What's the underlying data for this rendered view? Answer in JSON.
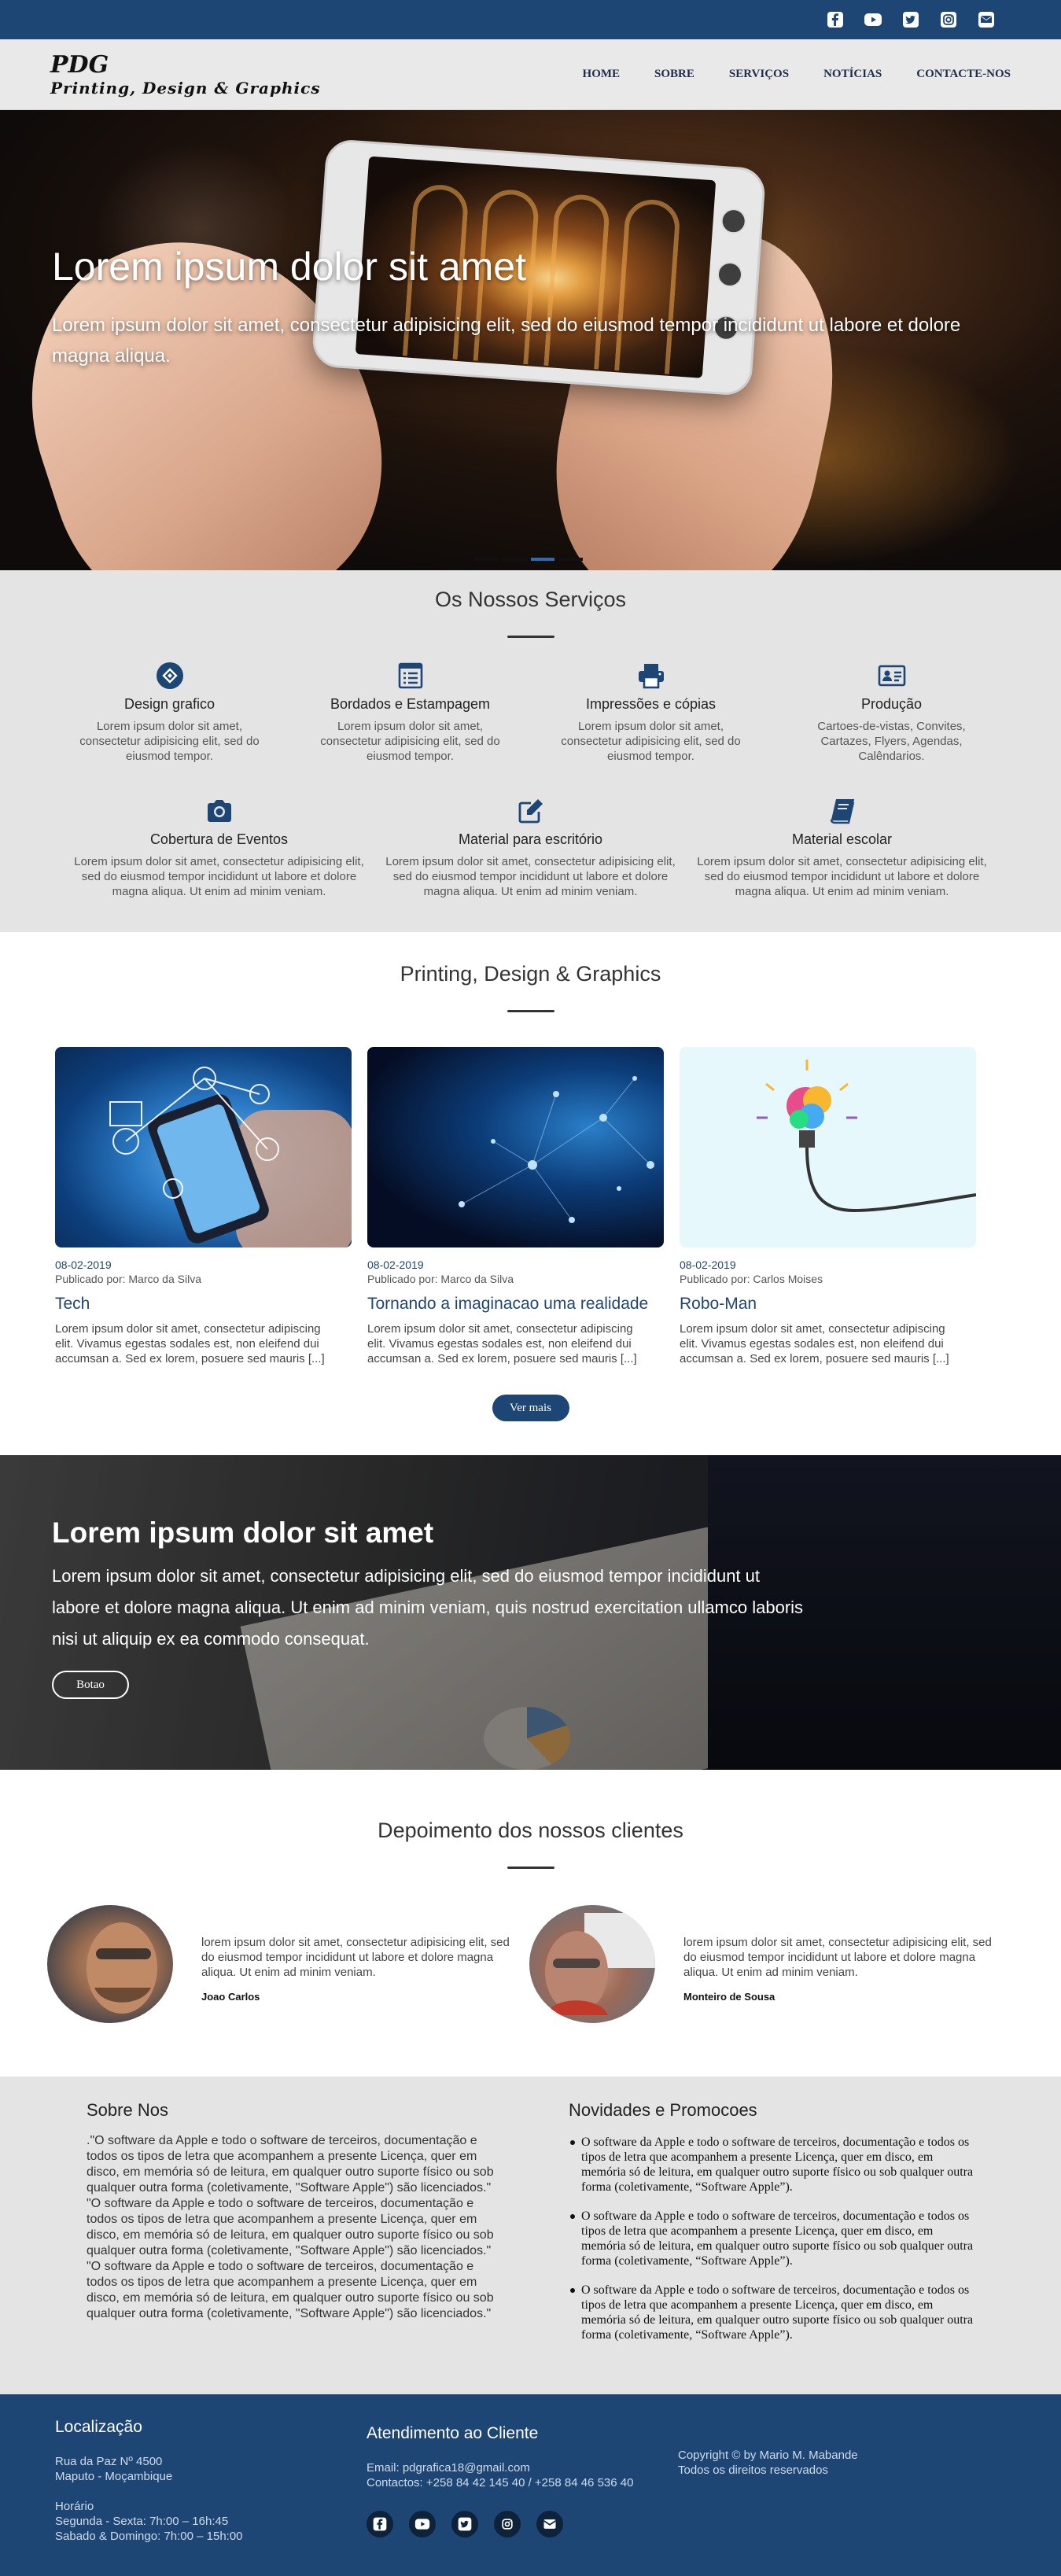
{
  "topbar": {
    "icons": [
      "facebook-icon",
      "youtube-icon",
      "twitter-icon",
      "instagram-icon",
      "email-icon"
    ]
  },
  "brand": {
    "title": "PDG",
    "subtitle": "Printing, Design & Graphics"
  },
  "nav": {
    "items": [
      "HOME",
      "SOBRE",
      "SERVIÇOS",
      "NOTÍCIAS",
      "CONTACTE-NOS"
    ]
  },
  "hero": {
    "title": "Lorem ipsum dolor sit amet",
    "description": "Lorem ipsum dolor sit amet, consectetur adipisicing elit, sed do eiusmod tempor incididunt ut labore et dolore magna aliqua.",
    "slides": 4,
    "active_slide": 3
  },
  "services": {
    "title": "Os Nossos Serviços",
    "items": [
      {
        "icon": "design-icon",
        "title": "Design grafico",
        "text": "Lorem ipsum dolor sit amet, consectetur adipisicing elit, sed do eiusmod tempor."
      },
      {
        "icon": "list-icon",
        "title": "Bordados e Estampagem",
        "text": "Lorem ipsum dolor sit amet, consectetur adipisicing elit, sed do eiusmod tempor."
      },
      {
        "icon": "printer-icon",
        "title": "Impressões e cópias",
        "text": "Lorem ipsum dolor sit amet, consectetur adipisicing elit, sed do eiusmod tempor."
      },
      {
        "icon": "id-card-icon",
        "title": "Produção",
        "text": "Cartoes-de-vistas, Convites, Cartazes, Flyers, Agendas, Calêndarios."
      },
      {
        "icon": "camera-icon",
        "title": "Cobertura de Eventos",
        "text": "Lorem ipsum dolor sit amet, consectetur adipisicing elit, sed do eiusmod tempor incididunt ut labore et dolore magna aliqua. Ut enim ad minim veniam."
      },
      {
        "icon": "edit-icon",
        "title": "Material para escritório",
        "text": "Lorem ipsum dolor sit amet, consectetur adipisicing elit, sed do eiusmod tempor incididunt ut labore et dolore magna aliqua. Ut enim ad minim veniam."
      },
      {
        "icon": "book-icon",
        "title": "Material escolar",
        "text": "Lorem ipsum dolor sit amet, consectetur adipisicing elit, sed do eiusmod tempor incididunt ut labore et dolore magna aliqua. Ut enim ad minim veniam."
      }
    ]
  },
  "blog": {
    "title": "Printing, Design & Graphics",
    "cards": [
      {
        "date": "08-02-2019",
        "author": "Publicado por: Marco da Silva",
        "title": "Tech",
        "text": "Lorem ipsum dolor sit amet, consectetur adipiscing elit. Vivamus egestas sodales est, non eleifend dui accumsan a. Sed ex lorem, posuere sed mauris [...]"
      },
      {
        "date": "08-02-2019",
        "author": "Publicado por: Marco da Silva",
        "title": "Tornando a imaginacao uma realidade",
        "text": "Lorem ipsum dolor sit amet, consectetur adipiscing elit. Vivamus egestas sodales est, non eleifend dui accumsan a. Sed ex lorem, posuere sed mauris [...]"
      },
      {
        "date": "08-02-2019",
        "author": "Publicado por: Carlos Moises",
        "title": "Robo-Man",
        "text": "Lorem ipsum dolor sit amet, consectetur adipiscing elit. Vivamus egestas sodales est, non eleifend dui accumsan a. Sed ex lorem, posuere sed mauris [...]"
      }
    ],
    "more_label": "Ver mais"
  },
  "banner": {
    "title": "Lorem ipsum dolor sit amet",
    "description": "Lorem ipsum dolor sit amet, consectetur adipisicing elit, sed do eiusmod tempor incididunt ut labore et dolore magna aliqua. Ut enim ad minim veniam, quis nostrud exercitation ullamco laboris nisi ut aliquip ex ea commodo consequat.",
    "button_label": "Botao"
  },
  "testimonials": {
    "title": "Depoimento dos nossos clientes",
    "items": [
      {
        "text": "lorem ipsum dolor sit amet, consectetur adipisicing elit, sed do eiusmod tempor incididunt ut labore et dolore magna aliqua. Ut enim ad minim veniam.",
        "name": "Joao Carlos"
      },
      {
        "text": "lorem ipsum dolor sit amet, consectetur adipisicing elit, sed do eiusmod tempor incididunt ut labore et dolore magna aliqua. Ut enim ad minim veniam.",
        "name": "Monteiro de Sousa"
      }
    ]
  },
  "about": {
    "title": "Sobre Nos",
    "paragraphs": [
      ".\"O software da Apple e todo o software de terceiros, documentação e todos os tipos de letra que acompanhem a presente Licença, quer em disco, em memória só de leitura, em qualquer outro suporte físico ou sob qualquer outra forma (coletivamente, \"Software Apple\") são licenciados.\"",
      "\"O software da Apple e todo o software de terceiros, documentação e todos os tipos de letra que acompanhem a presente Licença, quer em disco, em memória só de leitura, em qualquer outro suporte físico ou sob qualquer outra forma (coletivamente, \"Software Apple\") são licenciados.\"",
      "\"O software da Apple e todo o software de terceiros, documentação e todos os tipos de letra que acompanhem a presente Licença, quer em disco, em memória só de leitura, em qualquer outro suporte físico ou sob qualquer outra forma (coletivamente, \"Software Apple\") são licenciados.\""
    ]
  },
  "news": {
    "title": "Novidades e Promocoes",
    "items": [
      "O software da Apple e todo o software de terceiros, documentação e todos os tipos de letra que acompanhem a presente Licença, quer em disco, em memória só de leitura, em qualquer outro suporte físico ou sob qualquer outra forma (coletivamente, “Software Apple”).",
      "O software da Apple e todo o software de terceiros, documentação e todos os tipos de letra que acompanhem a presente Licença, quer em disco, em memória só de leitura, em qualquer outro suporte físico ou sob qualquer outra forma (coletivamente, “Software Apple”).",
      "O software da Apple e todo o software de terceiros, documentação e todos os tipos de letra que acompanhem a presente Licença, quer em disco, em memória só de leitura, em qualquer outro suporte físico ou sob qualquer outra forma (coletivamente, “Software Apple”)."
    ]
  },
  "footer": {
    "location_title": "Localização",
    "address_line1": "Rua da Paz Nº 4500",
    "address_line2": "Maputo - Moçambique",
    "hours_label": "Horário",
    "hours_weekdays": "Segunda - Sexta: 7h:00 – 16h:45",
    "hours_weekend": "Sabado & Domingo: 7h:00 – 15h:00",
    "service_title": "Atendimento ao Cliente",
    "email": "Email: pdgrafica18@gmail.com",
    "contacts": "Contactos: +258 84 42 145 40 / +258 84 46 536 40",
    "copyright": "Copyright © by Mario M. Mabande",
    "rights": "Todos os direitos reservados"
  },
  "colors": {
    "primary": "#1d4674",
    "light_gray": "#e4e4e4"
  }
}
